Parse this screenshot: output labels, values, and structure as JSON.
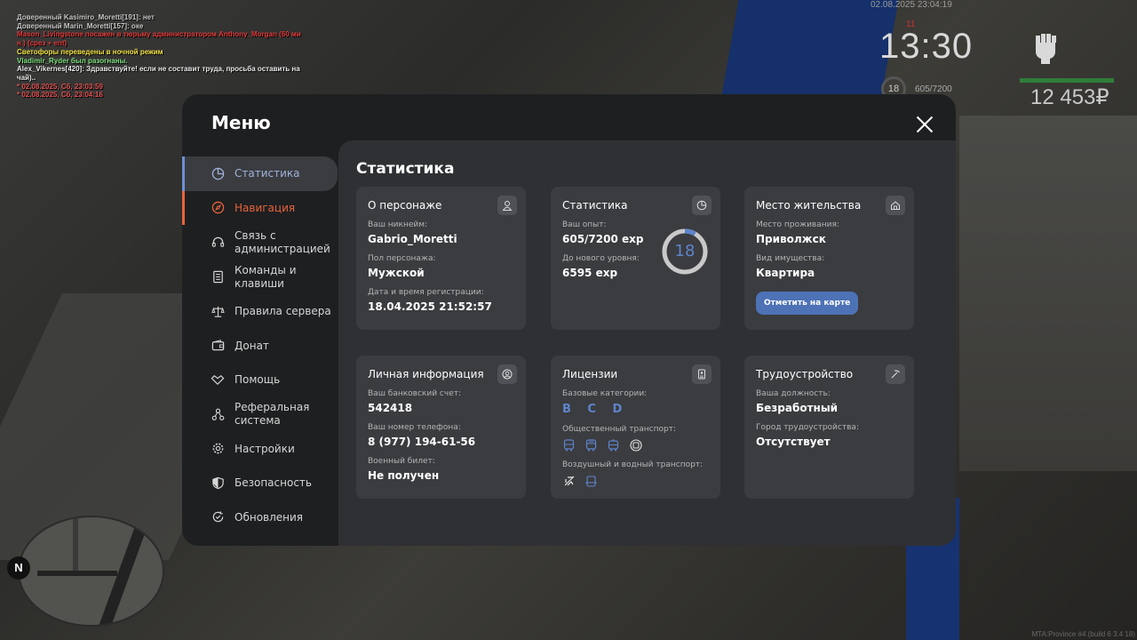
{
  "chat": [
    {
      "text": "Доверенный Kasimiro_Moretti[191]: нет",
      "color": "#c8c8c8"
    },
    {
      "text": "Доверенный Marin_Moretti[157]: оке",
      "color": "#c8c8c8"
    },
    {
      "text": "Mason_Livingstone посажен в тюрьму администратором Anthony_Morgan (60 ми",
      "color": "#e03a3a"
    },
    {
      "text": "н.) (срез + ent)",
      "color": "#e03a3a"
    },
    {
      "text": "Светофоры переведены в ночной режим",
      "color": "#f0e040"
    },
    {
      "text": "Vladimir_Ryder был разогнаны.",
      "color": "#7fe07f"
    },
    {
      "text": "Alex_Vikernes[420]: Здравствуйте! если не составит труда, просьба оставить на",
      "color": "#e8e8e8"
    },
    {
      "text": " чай)..",
      "color": "#e8e8e8"
    },
    {
      "text": " * 02.08.2025, Сб, 23:03:59",
      "color": "#e05050"
    },
    {
      "text": " * 02.08.2025, Сб, 23:04:16",
      "color": "#e05050"
    }
  ],
  "hud": {
    "datetime": "02.08.2025 23:04:19",
    "time": "13:30",
    "time_small": "11",
    "level": "18",
    "exp": "605/7200",
    "money": "12 453₽"
  },
  "minimap": {
    "north": "N"
  },
  "watermark": "MTA:Province #4 (build 6 3.4 18)",
  "menu": {
    "title": "Меню",
    "nav": [
      {
        "label": "Статистика",
        "icon": "pie-chart-icon"
      },
      {
        "label": "Навигация",
        "icon": "compass-icon"
      },
      {
        "label": "Связь с администрацией",
        "icon": "headset-icon"
      },
      {
        "label": "Команды и клавиши",
        "icon": "document-icon"
      },
      {
        "label": "Правила сервера",
        "icon": "scales-icon"
      },
      {
        "label": "Донат",
        "icon": "wallet-icon"
      },
      {
        "label": "Помощь",
        "icon": "handshake-icon"
      },
      {
        "label": "Реферальная система",
        "icon": "network-icon"
      },
      {
        "label": "Настройки",
        "icon": "gear-icon"
      },
      {
        "label": "Безопасность",
        "icon": "shield-icon"
      },
      {
        "label": "Обновления",
        "icon": "refresh-check-icon"
      }
    ],
    "section_title": "Статистика",
    "cards": {
      "character": {
        "title": "О персонаже",
        "nick_label": "Ваш никнейм:",
        "nick": "Gabrio_Moretti",
        "gender_label": "Пол персонажа:",
        "gender": "Мужской",
        "reg_label": "Дата и время регистрации:",
        "reg": "18.04.2025 21:52:57"
      },
      "stats": {
        "title": "Статистика",
        "exp_label": "Ваш опыт:",
        "exp": "605/7200 exp",
        "next_label": "До нового уровня:",
        "next": "6595 exp",
        "level": "18",
        "progress": 0.084
      },
      "residence": {
        "title": "Место жительства",
        "place_label": "Место проживания:",
        "place": "Приволжск",
        "property_label": "Вид имущества:",
        "property": "Квартира",
        "button": "Отметить на карте"
      },
      "personal": {
        "title": "Личная информация",
        "bank_label": "Ваш банковский счет:",
        "bank": "542418",
        "phone_label": "Ваш номер телефона:",
        "phone": "8 (977) 194-61-56",
        "military_label": "Военный билет:",
        "military": "Не получен"
      },
      "licenses": {
        "title": "Лицензии",
        "base_label": "Базовые категории:",
        "base": "B C D",
        "public_label": "Общественный транспорт:",
        "public_icons": [
          "bus-icon",
          "bus-icon",
          "tram-icon",
          "trolleybus-icon"
        ],
        "air_label": "Воздушный и водный транспорт:",
        "air_icons": [
          "airplane-icon",
          "boat-icon"
        ]
      },
      "employment": {
        "title": "Трудоустройство",
        "position_label": "Ваша должность:",
        "position": "Безработный",
        "city_label": "Город трудоустройства:",
        "city": "Отсутствует"
      }
    }
  }
}
